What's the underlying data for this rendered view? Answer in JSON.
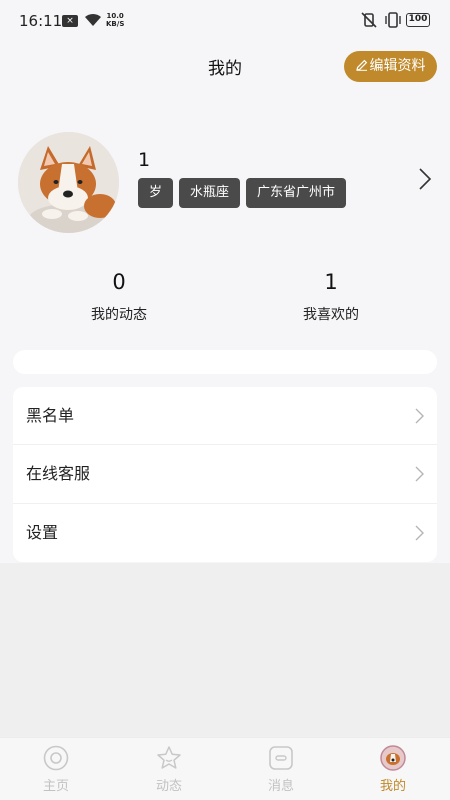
{
  "status_bar": {
    "time": "16:11",
    "speed_value": "10.0",
    "speed_unit": "KB/S",
    "battery": "100"
  },
  "header": {
    "title": "我的",
    "edit_label": "编辑资料"
  },
  "profile": {
    "nickname": "1",
    "tags": [
      "岁",
      "水瓶座",
      "广东省广州市"
    ]
  },
  "stats": [
    {
      "count": "0",
      "label": "我的动态"
    },
    {
      "count": "1",
      "label": "我喜欢的"
    }
  ],
  "menu": [
    {
      "label": "黑名单"
    },
    {
      "label": "在线客服"
    },
    {
      "label": "设置"
    }
  ],
  "tabs": [
    {
      "label": "主页",
      "icon": "home-icon"
    },
    {
      "label": "动态",
      "icon": "star-icon"
    },
    {
      "label": "消息",
      "icon": "message-icon"
    },
    {
      "label": "我的",
      "icon": "avatar-icon",
      "active": true
    }
  ],
  "colors": {
    "accent": "#c08a2c",
    "tag_bg": "#4a4a4a",
    "inactive_tab": "#c2c2c2"
  }
}
